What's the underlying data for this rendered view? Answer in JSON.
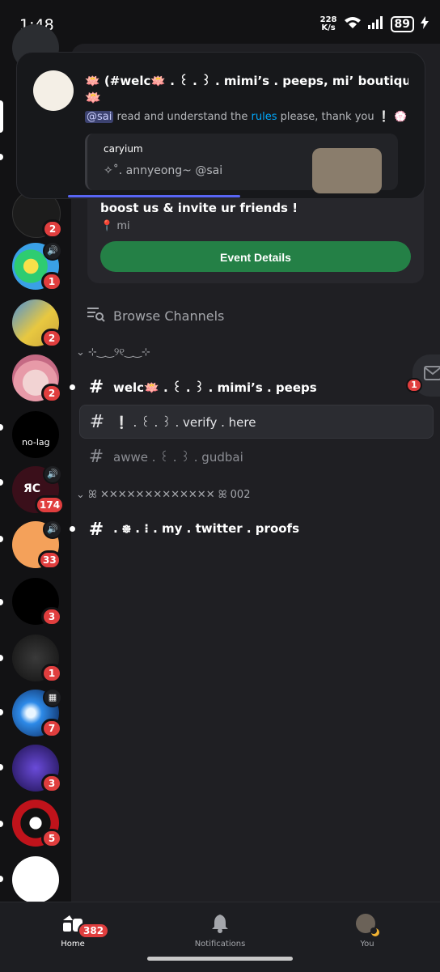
{
  "status": {
    "time": "1:48",
    "speed_value": "228",
    "speed_unit": "K/s",
    "battery": "89"
  },
  "notification": {
    "title": "🪷 (#welc🪷 . ꒰ . ꒱ . mimi’s . peeps, mi’ boutique ...",
    "emoji": "🪷",
    "mention": "@sai",
    "body_a": "read and understand the",
    "body_link": "rules",
    "body_b": "please, thank you ❕ 💮",
    "quote_author": "caryium",
    "quote_text": "✧˚. annyeong~ @sai"
  },
  "event": {
    "title": "boost us & invite ur friends !",
    "location": "mi",
    "button": "Event Details"
  },
  "browse": "Browse Channels",
  "category1": "⊹‿‿୨୧‿‿⊹",
  "category2": "ꕤ ✕✕✕✕✕✕✕✕✕✕✕✕✕ ꕤ 002",
  "channels": [
    {
      "name": "welc🪷 . ꒰ . ꒱ . mimi’s . peeps"
    },
    {
      "name": "❕ . ꒰ . ꒱ . verify . here"
    },
    {
      "name": "awwe . ꒰ . ꒱ . gudbai"
    },
    {
      "name": ". ᪥ . ⁝ . my . twitter . proofs"
    }
  ],
  "servers": [
    {
      "badge": "2"
    },
    {
      "badge": "1"
    },
    {
      "badge": "2"
    },
    {
      "badge": "2"
    },
    {
      "badge": ""
    },
    {
      "badge": "174"
    },
    {
      "badge": "33"
    },
    {
      "badge": "3"
    },
    {
      "badge": "1"
    },
    {
      "badge": "7"
    },
    {
      "badge": "3"
    },
    {
      "badge": "5"
    }
  ],
  "side_badge": "1",
  "nav": {
    "home": "Home",
    "home_badge": "382",
    "notifications": "Notifications",
    "you": "You"
  }
}
